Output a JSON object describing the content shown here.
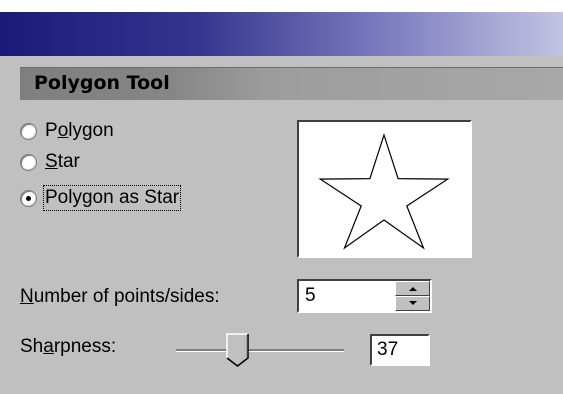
{
  "panel": {
    "title": "Polygon Tool"
  },
  "mode": {
    "options": [
      {
        "pre": "P",
        "key": "o",
        "post": "lygon",
        "checked": false
      },
      {
        "pre": "",
        "key": "S",
        "post": "tar",
        "checked": false
      },
      {
        "pre": "",
        "key": "",
        "post": "Polygon as Star",
        "checked": true
      }
    ]
  },
  "points": {
    "label_key": "N",
    "label_rest": "umber of points/sides:",
    "value": "5"
  },
  "sharpness": {
    "label_pre": "Sh",
    "label_key": "a",
    "label_post": "rpness:",
    "value": "37",
    "min": 0,
    "max": 100
  },
  "colors": {
    "face": "#c0c0c0",
    "title_dark": "#1a1a7a",
    "title_light": "#c3c3e2"
  },
  "icons": {
    "preview": "star-shape-icon",
    "spin_up": "arrow-up-icon",
    "spin_down": "arrow-down-icon"
  }
}
